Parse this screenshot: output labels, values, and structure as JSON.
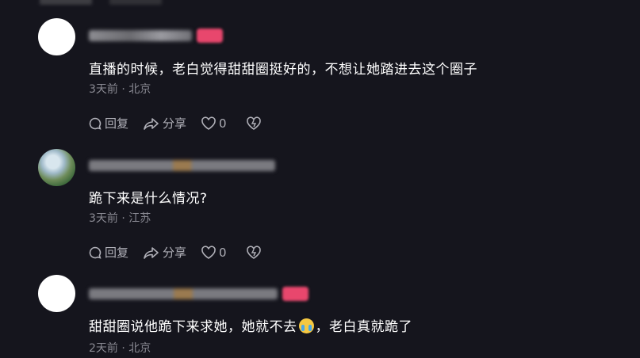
{
  "comments": [
    {
      "text": "直播的时候，老白觉得甜甜圈挺好的，不想让她踏进去这个圈子",
      "meta": "3天前 · 北京",
      "reply_label": "回复",
      "share_label": "分享",
      "like_count": "0"
    },
    {
      "text": "跪下来是什么情况?",
      "meta": "3天前 · 江苏",
      "reply_label": "回复",
      "share_label": "分享",
      "like_count": "0"
    },
    {
      "text_before": "甜甜圈说他跪下来求她，她就不去",
      "text_after": "，老白真就跪了",
      "emoji": "loudly-crying-face",
      "meta": "2天前 · 北京"
    }
  ],
  "colors": {
    "background": "#15151d",
    "tag": "#e8476d",
    "meta_text": "#8a8a93",
    "action_text": "#b0b0b8"
  },
  "icons": [
    "reply-icon",
    "share-icon",
    "heart-icon",
    "dislike-heart-icon"
  ]
}
